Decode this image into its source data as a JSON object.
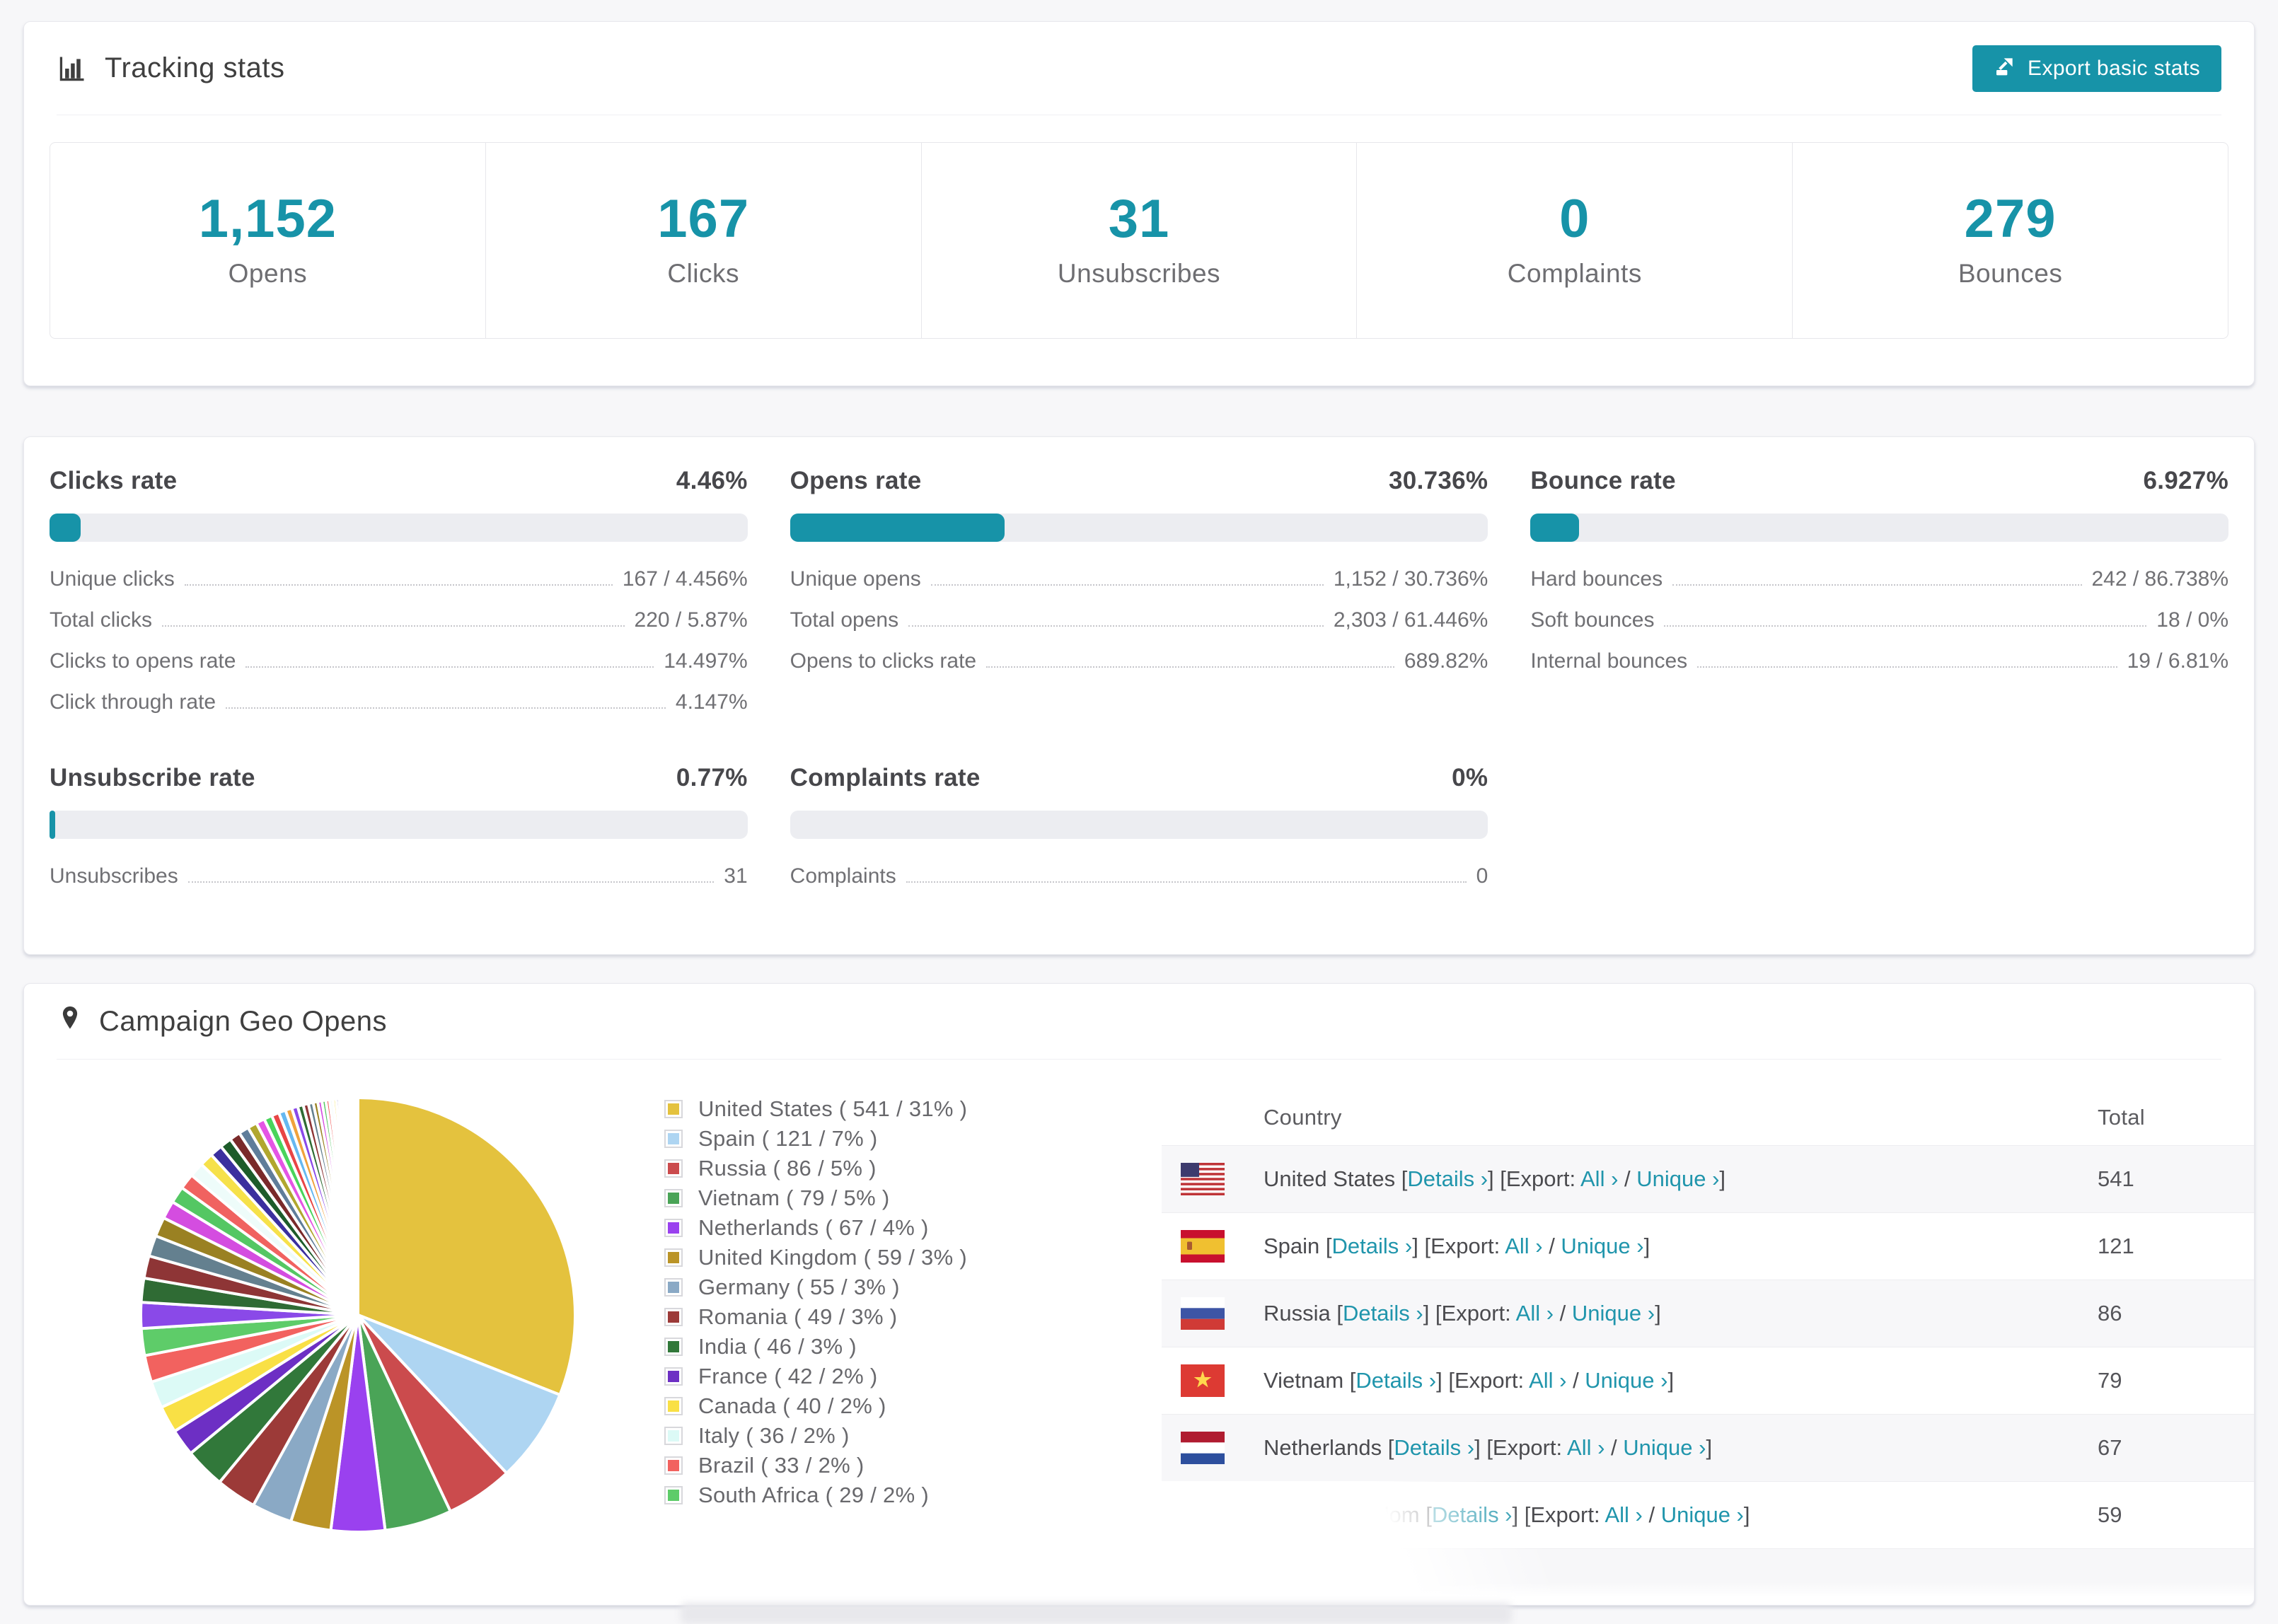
{
  "page": {
    "background": "#f7f7f9",
    "accent": "#1793a8"
  },
  "tracking_stats": {
    "title": "Tracking stats",
    "export_button_label": "Export basic stats",
    "summary": [
      {
        "value": "1,152",
        "label": "Opens"
      },
      {
        "value": "167",
        "label": "Clicks"
      },
      {
        "value": "31",
        "label": "Unsubscribes"
      },
      {
        "value": "0",
        "label": "Complaints"
      },
      {
        "value": "279",
        "label": "Bounces"
      }
    ]
  },
  "rates": [
    {
      "title": "Clicks rate",
      "value": "4.46%",
      "pct": 4.46,
      "rows": [
        {
          "label": "Unique clicks",
          "value": "167 / 4.456%"
        },
        {
          "label": "Total clicks",
          "value": "220 / 5.87%"
        },
        {
          "label": "Clicks to opens rate",
          "value": "14.497%"
        },
        {
          "label": "Click through rate",
          "value": "4.147%"
        }
      ]
    },
    {
      "title": "Opens rate",
      "value": "30.736%",
      "pct": 30.736,
      "rows": [
        {
          "label": "Unique opens",
          "value": "1,152 / 30.736%"
        },
        {
          "label": "Total opens",
          "value": "2,303 / 61.446%"
        },
        {
          "label": "Opens to clicks rate",
          "value": "689.82%"
        }
      ]
    },
    {
      "title": "Bounce rate",
      "value": "6.927%",
      "pct": 6.927,
      "rows": [
        {
          "label": "Hard bounces",
          "value": "242 / 86.738%"
        },
        {
          "label": "Soft bounces",
          "value": "18 / 0%"
        },
        {
          "label": "Internal bounces",
          "value": "19 / 6.81%"
        }
      ]
    },
    {
      "title": "Unsubscribe rate",
      "value": "0.77%",
      "pct": 0.77,
      "rows": [
        {
          "label": "Unsubscribes",
          "value": "31"
        }
      ]
    },
    {
      "title": "Complaints rate",
      "value": "0%",
      "pct": 0,
      "rows": [
        {
          "label": "Complaints",
          "value": "0"
        }
      ]
    }
  ],
  "geo": {
    "title": "Campaign Geo Opens",
    "columns": {
      "country": "Country",
      "total": "Total"
    },
    "links": {
      "details": "Details ›",
      "export": "Export:",
      "all": "All ›",
      "unique": "Unique ›"
    },
    "fmt": {
      "open": " [",
      "close_open": "] [",
      "slash": " / ",
      "close": "]"
    },
    "rows": [
      {
        "country": "United States",
        "flag": "us",
        "total": "541"
      },
      {
        "country": "Spain",
        "flag": "es",
        "total": "121"
      },
      {
        "country": "Russia",
        "flag": "ru",
        "total": "86"
      },
      {
        "country": "Vietnam",
        "flag": "vn",
        "total": "79"
      },
      {
        "country": "Netherlands",
        "flag": "nl",
        "total": "67"
      },
      {
        "country": "United Kingdom",
        "flag": "gb",
        "total": "59"
      },
      {
        "country": "",
        "flag": "de",
        "total": "",
        "partial": true
      }
    ]
  },
  "chart_data": {
    "type": "pie",
    "title": "Campaign Geo Opens",
    "legend_position": "right",
    "categories": [
      "United States",
      "Spain",
      "Russia",
      "Vietnam",
      "Netherlands",
      "United Kingdom",
      "Germany",
      "Romania",
      "India",
      "France",
      "Canada",
      "Italy",
      "Brazil",
      "South Africa"
    ],
    "values": [
      541,
      121,
      86,
      79,
      67,
      59,
      55,
      49,
      46,
      42,
      40,
      36,
      33,
      29
    ],
    "percents": [
      31,
      7,
      5,
      5,
      4,
      3,
      3,
      3,
      3,
      2,
      2,
      2,
      2,
      2
    ],
    "legend_labels": [
      "United States ( 541 / 31% )",
      "Spain ( 121 / 7% )",
      "Russia ( 86 / 5% )",
      "Vietnam ( 79 / 5% )",
      "Netherlands ( 67 / 4% )",
      "United Kingdom ( 59 / 3% )",
      "Germany ( 55 / 3% )",
      "Romania ( 49 / 3% )",
      "India ( 46 / 3% )",
      "France ( 42 / 2% )",
      "Canada ( 40 / 2% )",
      "Italy ( 36 / 2% )",
      "Brazil ( 33 / 2% )",
      "South Africa ( 29 / 2% )"
    ],
    "colors": [
      "#e4c23e",
      "#aed5f2",
      "#cb4b4d",
      "#4aa457",
      "#9a41ef",
      "#bb9427",
      "#8aa9c5",
      "#9c3a38",
      "#31783a",
      "#6d2fc4",
      "#f9e045",
      "#dcfaf6",
      "#f2625f",
      "#5ecc69"
    ],
    "others": {
      "pct_total": 26,
      "slice_count": 40,
      "decay": 0.93,
      "palette": [
        "#8a49e8",
        "#2f6b34",
        "#8e3536",
        "#64808f",
        "#9a8122",
        "#d44de0",
        "#54c763",
        "#f06260",
        "#eefcfa",
        "#f6e14a",
        "#3b2f9e",
        "#1d5c2a",
        "#7a2a2a",
        "#5f7d9a",
        "#b1a72e",
        "#e455e4",
        "#49d45b",
        "#e84545",
        "#66b8f0",
        "#f0a23c"
      ]
    }
  }
}
